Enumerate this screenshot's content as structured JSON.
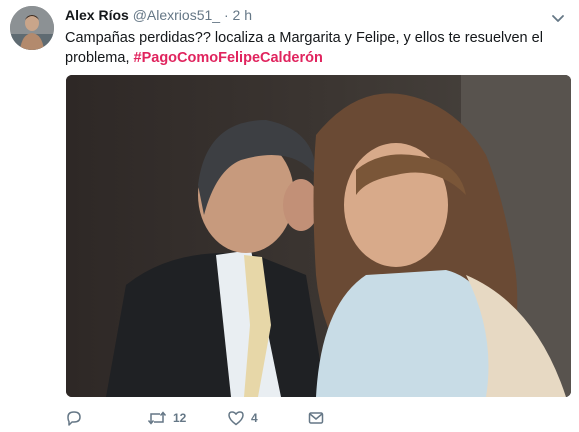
{
  "tweet": {
    "author_name": "Alex Ríos",
    "author_handle": "@Alexrios51_",
    "separator": "·",
    "time": "2 h",
    "text_main": "Campañas perdidas?? localiza a Margarita y Felipe, y ellos te resuelven el problema, ",
    "hashtag": "#PagoComoFelipeCalderón",
    "hashtag_color": "#e0245e"
  },
  "icons": {
    "avatar": "avatar",
    "more": "chevron-down-icon",
    "reply": "reply-icon",
    "retweet": "retweet-icon",
    "like": "heart-icon",
    "dm": "message-icon"
  },
  "actions": {
    "reply_count": "",
    "retweet_count": "12",
    "like_count": "4"
  }
}
